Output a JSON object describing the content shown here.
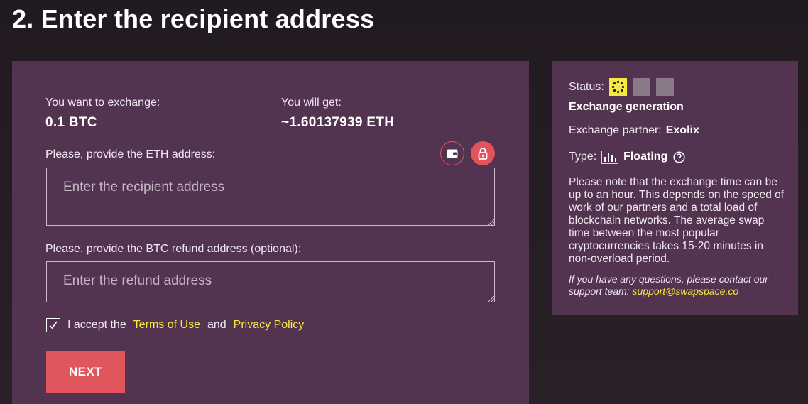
{
  "page": {
    "title": "2. Enter the recipient address"
  },
  "exchange": {
    "send_label": "You want to exchange:",
    "send_value": "0.1 BTC",
    "get_label": "You will get:",
    "get_value": "~1.60137939 ETH"
  },
  "form": {
    "eth_label": "Please, provide the ETH address:",
    "eth_placeholder": "Enter the recipient address",
    "btc_label": "Please, provide the BTC refund address (optional):",
    "btc_placeholder": "Enter the refund address",
    "wallet_icon": "wallet-icon",
    "lock_icon": "lock-icon",
    "terms_checked": true,
    "terms_prefix": "I accept the",
    "terms_link": "Terms of Use",
    "terms_and": "and",
    "privacy_link": "Privacy Policy",
    "next_label": "NEXT"
  },
  "status": {
    "label": "Status:",
    "steps": [
      {
        "state": "active",
        "icon": "loading-dots-icon"
      },
      {
        "state": "inactive"
      },
      {
        "state": "inactive"
      }
    ],
    "current": "Exchange generation",
    "partner_label": "Exchange partner:",
    "partner_value": "Exolix",
    "type_label": "Type:",
    "type_icon": "floating-chart-icon",
    "type_value": "Floating",
    "help_icon": "help-circle-icon",
    "note": "Please note that the exchange time can be up to an hour. This depends on the speed of work of our partners and a total load of blockchain networks. The average swap time between the most popular cryptocurrencies takes 15-20 minutes in non-overload period.",
    "contact_text": "If you have any questions, please contact our support team:",
    "contact_email": "support@swapspace.co"
  },
  "colors": {
    "background": "#231b22",
    "card": "#533450",
    "accent": "#e1565d",
    "link": "#f6e840",
    "step_inactive": "#8a7a87"
  }
}
